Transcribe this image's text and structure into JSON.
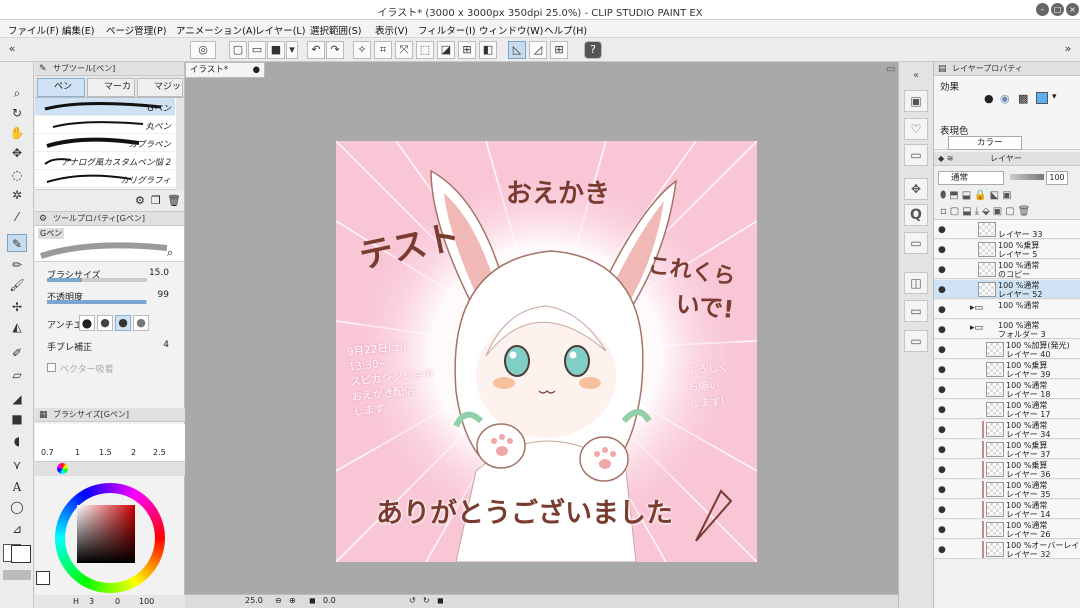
{
  "window": {
    "title": "イラスト* (3000 x 3000px 350dpi 25.0%)  - CLIP STUDIO PAINT EX"
  },
  "menu": [
    "ファイル(F)",
    "編集(E)",
    "ページ管理(P)",
    "アニメーション(A)",
    "レイヤー(L)",
    "選択範囲(S)",
    "表示(V)",
    "フィルター(I)",
    "ウィンドウ(W)",
    "ヘルプ(H)"
  ],
  "subtool": {
    "header": "サブツール[ペン]",
    "tabs": [
      "ペン",
      "マーカ",
      "マジック"
    ],
    "brushes": [
      "Gペン",
      "丸ペン",
      "カブラペン",
      "アナログ風カスタムペン悩 2",
      "カリグラフィ"
    ]
  },
  "toolprop": {
    "header": "ツールプロパティ[Gペン]",
    "brush_name": "Gペン",
    "size_label": "ブラシサイズ",
    "size_value": "15.0",
    "size_level": 0.35,
    "opacity_label": "不透明度",
    "opacity_value": "99",
    "opacity_level": 0.99,
    "aa_label": "アンチエ",
    "stab_label": "手ブレ補正",
    "stab_value": "4",
    "vector_label": "ベクター吸着"
  },
  "brushsize": {
    "header": "ブラシサイズ[Gペン]",
    "sizes": [
      "0.7",
      "1",
      "1.5",
      "2",
      "2.5"
    ]
  },
  "color": {
    "bottom_values": [
      "3",
      "0",
      "100"
    ]
  },
  "document": {
    "tab": "イラスト*"
  },
  "status": {
    "zoom": "25.0",
    "angle": "0.0"
  },
  "artwork": {
    "title_left": "テスト",
    "title_top": "おえかき",
    "right_line1": "これくら",
    "right_line2": "いで!",
    "left_note": [
      "9月22日(土)",
      "13:30~",
      "スピカシンジョの",
      "おえかき配信",
      "します"
    ],
    "right_note": [
      "よろしく",
      "お願い",
      "します!"
    ],
    "bottom": "ありがとうございました"
  },
  "layerprop": {
    "header": "レイヤープロパティ",
    "effect_label": "効果",
    "expr_label": "表現色",
    "expr_value": "カラー"
  },
  "layers": {
    "header": "レイヤー",
    "blend": "通常",
    "opacity": "100",
    "items": [
      {
        "mode": "",
        "name": "レイヤー 33"
      },
      {
        "mode": "100 %乗算",
        "name": "レイヤー 5"
      },
      {
        "mode": "100 %通常",
        "name": "のコピー"
      },
      {
        "mode": "100 %通常",
        "name": "レイヤー 52"
      },
      {
        "mode": "100 %通常",
        "name": ""
      },
      {
        "mode": "100 %通常",
        "name": "フォルダー 3"
      },
      {
        "mode": "100 %加算(発光)",
        "name": "レイヤー 40"
      },
      {
        "mode": "100 %乗算",
        "name": "レイヤー 39"
      },
      {
        "mode": "100 %通常",
        "name": "レイヤー 18"
      },
      {
        "mode": "100 %通常",
        "name": "レイヤー 17"
      },
      {
        "mode": "100 %通常",
        "name": "レイヤー 34"
      },
      {
        "mode": "100 %乗算",
        "name": "レイヤー 37"
      },
      {
        "mode": "100 %乗算",
        "name": "レイヤー 36"
      },
      {
        "mode": "100 %通常",
        "name": "レイヤー 35"
      },
      {
        "mode": "100 %通常",
        "name": "レイヤー 14"
      },
      {
        "mode": "100 %通常",
        "name": "レイヤー 26"
      },
      {
        "mode": "100 %オーバーレイ",
        "name": "レイヤー 32"
      }
    ]
  },
  "colors": {
    "accent": "#cfe2f3",
    "canvas_bg": "#a9a9a9",
    "art_pink": "#f9c6d6",
    "ink": "#7a3b30"
  }
}
